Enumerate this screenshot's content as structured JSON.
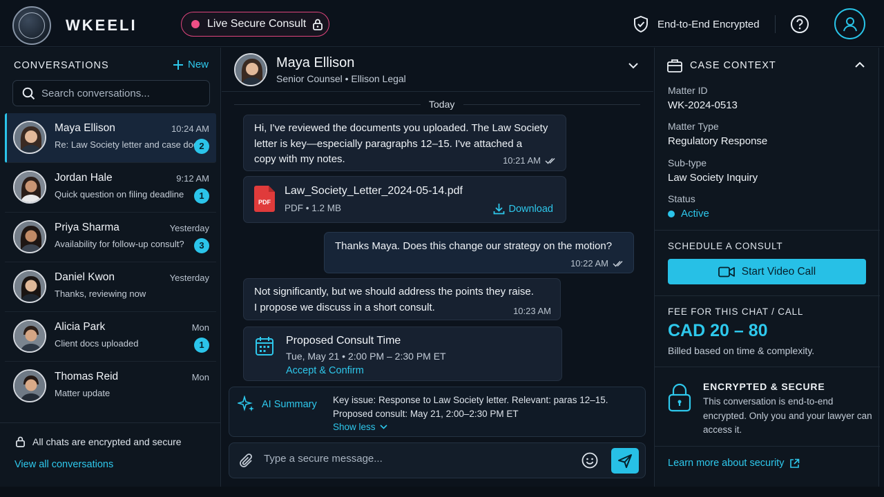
{
  "header": {
    "brand": "WKEELI",
    "live_pill": "Live Secure Consult",
    "encryption_label": "End-to-End Encrypted"
  },
  "sidebar": {
    "title": "CONVERSATIONS",
    "new_label": "New",
    "search_placeholder": "Search conversations...",
    "conversations": [
      {
        "name": "Maya Ellison",
        "time": "10:24 AM",
        "preview": "Re: Law Society letter and case docs",
        "badge": "2",
        "active": true
      },
      {
        "name": "Jordan Hale",
        "time": "9:12 AM",
        "preview": "Quick question on filing deadline",
        "badge": "1"
      },
      {
        "name": "Priya Sharma",
        "time": "Yesterday",
        "preview": "Availability for follow-up consult?",
        "badge": "3"
      },
      {
        "name": "Daniel Kwon",
        "time": "Yesterday",
        "preview": "Thanks, reviewing now",
        "badge": ""
      },
      {
        "name": "Alicia Park",
        "time": "Mon",
        "preview": "Client docs uploaded",
        "badge": "1"
      },
      {
        "name": "Thomas Reid",
        "time": "Mon",
        "preview": "Matter update",
        "badge": ""
      }
    ],
    "footer_secure": "All chats are encrypted and secure",
    "footer_link": "View all conversations"
  },
  "chat": {
    "contact_name": "Maya Ellison",
    "contact_subtitle": "Senior Counsel • Ellison Legal",
    "day_divider": "Today",
    "messages": [
      {
        "direction": "in",
        "lines": [
          "Hi, I've reviewed the documents you uploaded. The Law Society",
          "letter is key—especially paragraphs 12–15. I've attached a",
          "copy with my notes."
        ],
        "time": "10:21 AM"
      },
      {
        "direction": "out",
        "lines": [
          "Thanks Maya. Does this change our strategy on the motion?"
        ],
        "time": "10:22 AM"
      },
      {
        "direction": "in",
        "lines": [
          "Not significantly, but we should address the points they raise.",
          "I propose we discuss in a short consult."
        ],
        "time": "10:23 AM"
      }
    ],
    "attachment": {
      "file_name": "Law_Society_Letter_2024-05-14.pdf",
      "icon_label": "PDF",
      "meta": "PDF • 1.2 MB",
      "download_label": "Download"
    },
    "consult": {
      "title": "Proposed Consult Time",
      "when": "Tue, May 21 • 2:00 PM – 2:30 PM ET",
      "action": "Accept & Confirm"
    },
    "ai_summary": {
      "label": "AI Summary",
      "lines": [
        "Key issue: Response to Law Society letter. Relevant: paras 12–15.",
        "Proposed consult: May 21, 2:00–2:30 PM ET"
      ],
      "toggle": "Show less"
    },
    "composer_placeholder": "Type a secure message..."
  },
  "case_panel": {
    "title": "CASE CONTEXT",
    "fields": [
      {
        "label": "Matter ID",
        "value": "WK-2024-0513"
      },
      {
        "label": "Matter Type",
        "value": "Regulatory Response"
      },
      {
        "label": "Sub-type",
        "value": "Law Society Inquiry"
      }
    ],
    "status_label": "Status",
    "status_value": "Active",
    "schedule_title": "SCHEDULE A CONSULT",
    "video_button": "Start Video Call",
    "fee_title": "FEE FOR THIS CHAT / CALL",
    "fee_value": "CAD 20 – 80",
    "fee_note": "Billed based on time & complexity.",
    "secure_title": "ENCRYPTED & SECURE",
    "secure_text": "This conversation is end-to-end encrypted. Only you and your lawyer can access it.",
    "learn_more": "Learn more about security"
  },
  "colors": {
    "accent": "#2ec8ec",
    "live": "#ef4f86",
    "background": "#0b121b",
    "panel": "#0e161f"
  }
}
